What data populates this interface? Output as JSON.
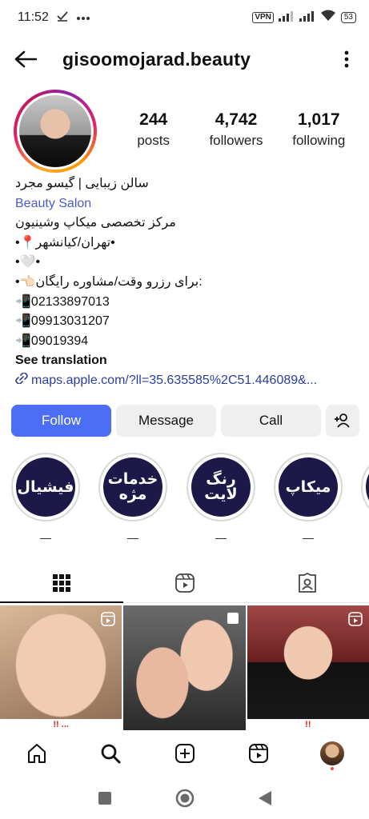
{
  "status_bar": {
    "time": "11:52",
    "vpn_label": "VPN",
    "battery": "53",
    "icons": [
      "check-icon",
      "more-dots-icon",
      "signal-icon",
      "signal-icon",
      "wifi-icon",
      "battery-icon"
    ]
  },
  "header": {
    "username": "gisoomojarad.beauty"
  },
  "stats": [
    {
      "value": "244",
      "label": "posts"
    },
    {
      "value": "4,742",
      "label": "followers"
    },
    {
      "value": "1,017",
      "label": "following"
    }
  ],
  "bio": {
    "name": "سالن زیبایی | گیسو مجرد",
    "category": "Beauty Salon",
    "lines": [
      "مرکز تخصصی میکاپ وشینیون",
      "•📍تهران/کیانشهر•",
      "•🤍•",
      "•👈🏻برای رزرو وقت/مشاوره رایگان:",
      "📲02133897013",
      "📲09913031207",
      "📲09019394"
    ],
    "see_translation": "See translation",
    "link": "maps.apple.com/?ll=35.635585%2C51.446089&..."
  },
  "buttons": {
    "follow": "Follow",
    "message": "Message",
    "call": "Call"
  },
  "highlights": [
    {
      "cover_text": "فیشیال",
      "label": "—"
    },
    {
      "cover_text": "خدمات\nمژه",
      "label": "—"
    },
    {
      "cover_text": "رنگ\nلایت",
      "label": "—"
    },
    {
      "cover_text": "میکاپ",
      "label": "—"
    }
  ],
  "tabs": [
    "grid-icon",
    "reels-icon",
    "tagged-icon"
  ],
  "posts": [
    {
      "caption": "!! ..."
    },
    {
      "caption": ""
    },
    {
      "caption": "!!"
    }
  ],
  "bottom_nav": [
    "home-icon",
    "search-icon",
    "create-icon",
    "reels-icon",
    "profile-avatar"
  ],
  "colors": {
    "follow_button": "#4c6ef5",
    "category_text": "#4a5cc5",
    "link_text": "#2b3d9e",
    "highlight_bg": "#1c1848"
  }
}
